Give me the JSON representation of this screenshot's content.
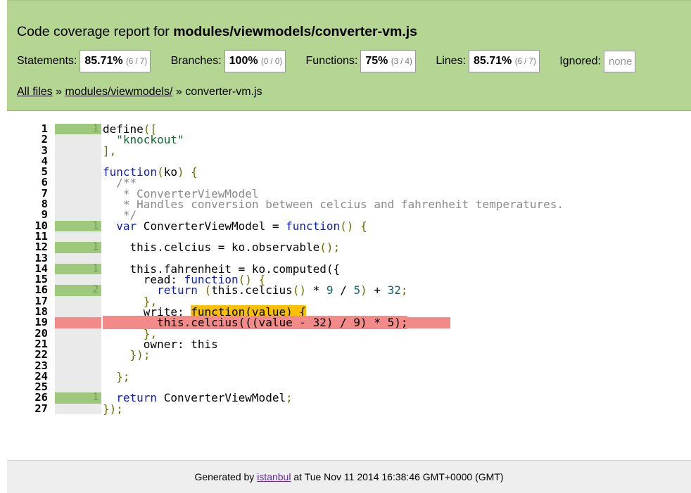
{
  "header": {
    "title_prefix": "Code coverage report for ",
    "title_file": "modules/viewmodels/converter-vm.js"
  },
  "stats": {
    "statements": {
      "label": "Statements:",
      "pct": "85.71%",
      "frac": "(6 / 7)"
    },
    "branches": {
      "label": "Branches:",
      "pct": "100%",
      "frac": "(0 / 0)"
    },
    "functions": {
      "label": "Functions:",
      "pct": "75%",
      "frac": "(3 / 4)"
    },
    "lines": {
      "label": "Lines:",
      "pct": "85.71%",
      "frac": "(6 / 7)"
    },
    "ignored": {
      "label": "Ignored:",
      "value": "none"
    }
  },
  "breadcrumb": {
    "all_files": "All files",
    "sep1": " » ",
    "dir": "modules/viewmodels/",
    "sep2": " » ",
    "file": "converter-vm.js"
  },
  "code": {
    "lines": [
      {
        "n": "1",
        "count": "1",
        "cov": "hit"
      },
      {
        "n": "2",
        "count": "",
        "cov": "none"
      },
      {
        "n": "3",
        "count": "",
        "cov": "none"
      },
      {
        "n": "4",
        "count": "",
        "cov": "none"
      },
      {
        "n": "5",
        "count": "",
        "cov": "none"
      },
      {
        "n": "6",
        "count": "",
        "cov": "none"
      },
      {
        "n": "7",
        "count": "",
        "cov": "none"
      },
      {
        "n": "8",
        "count": "",
        "cov": "none"
      },
      {
        "n": "9",
        "count": "",
        "cov": "none"
      },
      {
        "n": "10",
        "count": "1",
        "cov": "hit"
      },
      {
        "n": "11",
        "count": "",
        "cov": "none"
      },
      {
        "n": "12",
        "count": "1",
        "cov": "hit"
      },
      {
        "n": "13",
        "count": "",
        "cov": "none"
      },
      {
        "n": "14",
        "count": "1",
        "cov": "hit"
      },
      {
        "n": "15",
        "count": "",
        "cov": "none"
      },
      {
        "n": "16",
        "count": "2",
        "cov": "hit"
      },
      {
        "n": "17",
        "count": "",
        "cov": "none"
      },
      {
        "n": "18",
        "count": "",
        "cov": "none"
      },
      {
        "n": "19",
        "count": "",
        "cov": "miss"
      },
      {
        "n": "20",
        "count": "",
        "cov": "none"
      },
      {
        "n": "21",
        "count": "",
        "cov": "none"
      },
      {
        "n": "22",
        "count": "",
        "cov": "none"
      },
      {
        "n": "23",
        "count": "",
        "cov": "none"
      },
      {
        "n": "24",
        "count": "",
        "cov": "none"
      },
      {
        "n": "25",
        "count": "",
        "cov": "none"
      },
      {
        "n": "26",
        "count": "1",
        "cov": "hit"
      },
      {
        "n": "27",
        "count": "",
        "cov": "none"
      }
    ],
    "source": [
      "define([",
      "  \"knockout\"",
      "],",
      "",
      "function(ko) {",
      "  /**",
      "   * ConverterViewModel",
      "   * Handles conversion between celcius and fahrenheit temperatures.",
      "   */",
      "  var ConverterViewModel = function() {",
      "",
      "    this.celcius = ko.observable();",
      "",
      "    this.fahrenheit = ko.computed({",
      "      read: function() {",
      "        return (this.celcius() * 9 / 5) + 32;",
      "      },",
      "      write: function(value) {",
      "        this.celcius(((value - 32) / 9) * 5);",
      "      },",
      "      owner: this",
      "    });",
      "",
      "  };",
      "",
      "  return ConverterViewModel;",
      "});"
    ]
  },
  "footer": {
    "prefix": "Generated by ",
    "tool": "istanbul",
    "suffix": " at Tue Nov 11 2014 16:38:46 GMT+0000 (GMT)"
  },
  "colors": {
    "header_bg": "#b5d592",
    "covered": "#9ec97d",
    "uncovered": "#f28a8a",
    "function_not_covered": "#f8c000"
  }
}
